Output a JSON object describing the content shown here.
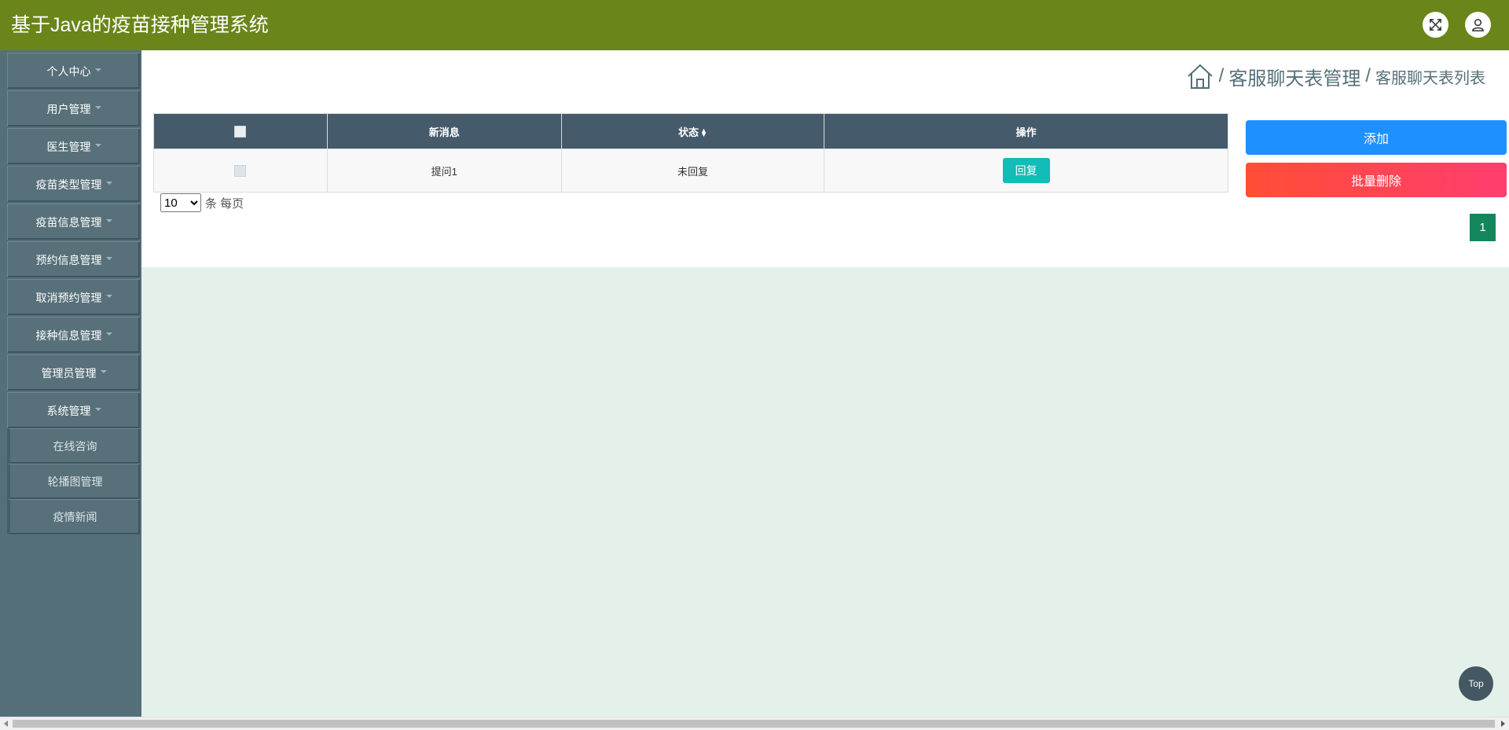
{
  "header": {
    "title": "基于Java的疫苗接种管理系统",
    "icons": [
      "fullscreen-icon",
      "user-icon"
    ]
  },
  "sidebar": {
    "items": [
      {
        "label": "个人中心",
        "has_dropdown": true
      },
      {
        "label": "用户管理",
        "has_dropdown": true
      },
      {
        "label": "医生管理",
        "has_dropdown": true
      },
      {
        "label": "疫苗类型管理",
        "has_dropdown": true
      },
      {
        "label": "疫苗信息管理",
        "has_dropdown": true
      },
      {
        "label": "预约信息管理",
        "has_dropdown": true
      },
      {
        "label": "取消预约管理",
        "has_dropdown": true
      },
      {
        "label": "接种信息管理",
        "has_dropdown": true
      },
      {
        "label": "管理员管理",
        "has_dropdown": true
      },
      {
        "label": "系统管理",
        "has_dropdown": true
      },
      {
        "label": "在线咨询",
        "has_dropdown": false
      },
      {
        "label": "轮播图管理",
        "has_dropdown": false
      },
      {
        "label": "疫情新闻",
        "has_dropdown": false
      }
    ]
  },
  "breadcrumb": {
    "separator": "/",
    "level1": "客服聊天表管理",
    "level2": "客服聊天表列表",
    "icon": "home-icon"
  },
  "table": {
    "columns": [
      "新消息",
      "状态",
      "操作"
    ],
    "rows": [
      {
        "message": "提问1",
        "status": "未回复",
        "action": "回复"
      }
    ]
  },
  "pagination": {
    "page_size": "10",
    "page_size_options": [
      "10"
    ],
    "page_size_label": "条 每页",
    "current_page": "1"
  },
  "actions": {
    "add_label": "添加",
    "batch_delete_label": "批量删除"
  },
  "back_to_top": "Top",
  "colors": {
    "header": "#6a8519",
    "sidebar": "#556f79",
    "table_header": "#455a6a",
    "add": "#1e90ff",
    "delete": "#ff4e35",
    "reply": "#13bcb6",
    "page": "#13875b"
  }
}
